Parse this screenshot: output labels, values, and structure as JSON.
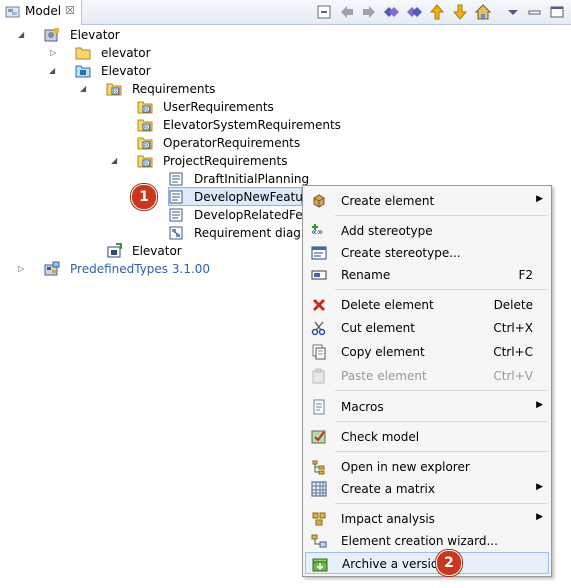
{
  "view": {
    "tab_title": "Model",
    "tab_close": "☒"
  },
  "toolbar": {
    "icons": [
      "collapse-all-icon",
      "back-arrow-icon",
      "forward-arrow-icon",
      "link-left-icon",
      "link-right-icon",
      "up-arrow-icon",
      "down-arrow-icon",
      "home-icon",
      "view-menu-icon",
      "minimize-icon",
      "maximize-icon"
    ]
  },
  "tree": {
    "root": "Elevator",
    "elevator_folder": "elevator",
    "elevator_model": "Elevator",
    "requirements": "Requirements",
    "user_requirements": "UserRequirements",
    "elevator_system_requirements": "ElevatorSystemRequirements",
    "operator_requirements": "OperatorRequirements",
    "project_requirements": "ProjectRequirements",
    "draft_initial_planning": "DraftInitialPlanning",
    "develop_new_feature": "DevelopNewFeature",
    "develop_related_feature": "DevelopRelatedFeatu",
    "requirement_diagram": "Requirement diagran",
    "elevator_component": "Elevator",
    "predefined_types": "PredefinedTypes 3.1.00"
  },
  "markers": {
    "one": "1",
    "two": "2"
  },
  "menu": {
    "create_element": "Create element",
    "add_stereotype": "Add stereotype",
    "create_stereotype": "Create stereotype...",
    "rename": "Rename",
    "rename_key": "F2",
    "delete_element": "Delete element",
    "delete_key": "Delete",
    "cut_element": "Cut element",
    "cut_key": "Ctrl+X",
    "copy_element": "Copy element",
    "copy_key": "Ctrl+C",
    "paste_element": "Paste element",
    "paste_key": "Ctrl+V",
    "macros": "Macros",
    "check_model": "Check model",
    "open_explorer": "Open in new explorer",
    "create_matrix": "Create a matrix",
    "impact_analysis": "Impact analysis",
    "creation_wizard": "Element creation wizard...",
    "archive_version": "Archive a version",
    "submenu_arrow": "▶"
  },
  "colors": {
    "accent_selection": "#dbe9fb",
    "marker_red": "#c8361b",
    "link_blue": "#3060b0"
  }
}
